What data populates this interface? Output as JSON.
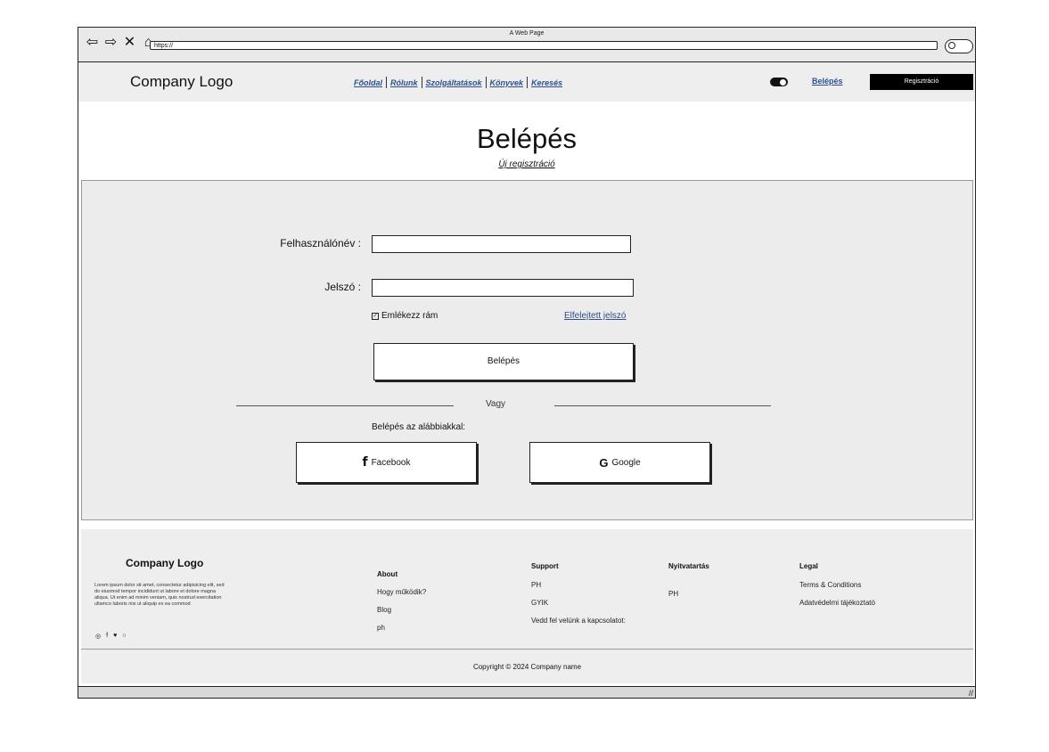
{
  "window": {
    "title": "A Web Page",
    "url": "https://",
    "nav_icons": [
      "⇦",
      "⇨",
      "✕",
      "⌂"
    ]
  },
  "header": {
    "logo": "Company Logo",
    "menu": [
      "Főoldal",
      "Rólunk",
      "Szolgáltatások",
      "Könyvek",
      "Keresés"
    ],
    "login_link": "Belépés",
    "register_button": "Regisztráció"
  },
  "main": {
    "title": "Belépés",
    "new_registration": "Új regisztráció",
    "username_label": "Felhasználónév :",
    "password_label": "Jelszó :",
    "remember_me": "Emlékezz rám",
    "forgot_password": "Elfelejtett jelszó",
    "login_button": "Belépés",
    "or_text": "Vagy",
    "social_label": "Belépés az alábbiakkal:",
    "facebook_button": "Facebook",
    "google_button": "Google"
  },
  "footer": {
    "logo": "Company Logo",
    "lorem": "Lorem ipsum dolor sit amet, consectetur adipisicing elit, sed do eiusmod tempor incididunt ut labore et dolore magna aliqua. Ut enim ad minim veniam, quis nostrud exercitation ullamco laboris nisi ut aliquip ex ea commod",
    "social_icons": [
      "instagram-icon",
      "facebook-icon",
      "twitter-icon",
      "github-icon"
    ],
    "about": {
      "heading": "About",
      "items": [
        "Hogy működik?",
        "Blog",
        "ph"
      ]
    },
    "support": {
      "heading": "Support",
      "items": [
        "PH",
        "GYIK",
        "Vedd fel velünk a kapcsolatot:"
      ]
    },
    "opening": {
      "heading": "Nyitvatartás",
      "items": [
        "PH"
      ]
    },
    "legal": {
      "heading": "Legal",
      "items": [
        "Terms & Conditions",
        "Adatvédelmi tájékoztató"
      ]
    },
    "copyright": "Copyright © 2024 Company name"
  }
}
